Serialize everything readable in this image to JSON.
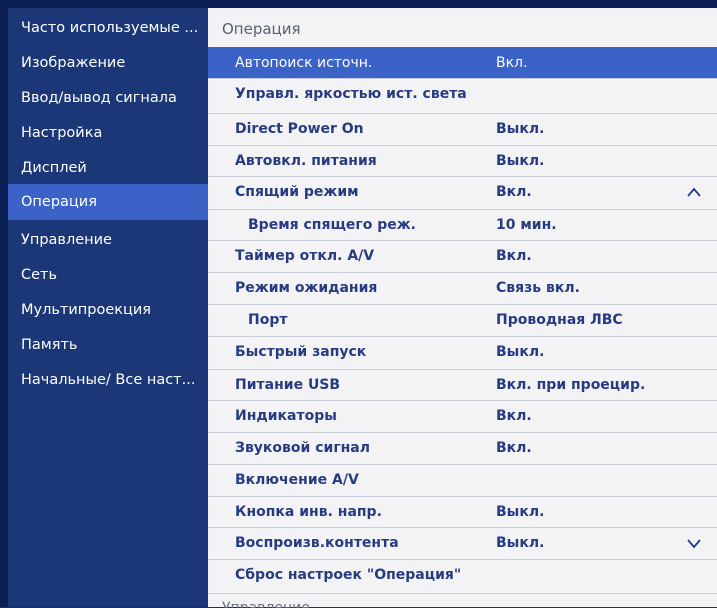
{
  "sidebar": {
    "items": [
      {
        "label": "Часто используемые ..."
      },
      {
        "label": "Изображение"
      },
      {
        "label": "Ввод/вывод сигнала"
      },
      {
        "label": "Настройка"
      },
      {
        "label": "Дисплей"
      },
      {
        "label": "Операция"
      },
      {
        "label": "Управление"
      },
      {
        "label": "Сеть"
      },
      {
        "label": "Мультипроекция"
      },
      {
        "label": "Память"
      },
      {
        "label": "Начальные/ Все наст..."
      }
    ],
    "selected": "Операция"
  },
  "main": {
    "title": "Операция",
    "rows": [
      {
        "label": "Автопоиск источн.",
        "value": "Вкл."
      },
      {
        "label": "Управл. яркостью ист. света",
        "value": ""
      },
      {
        "label": "Direct Power On",
        "value": "Выкл."
      },
      {
        "label": "Автовкл. питания",
        "value": "Выкл."
      },
      {
        "label": "Спящий режим",
        "value": "Вкл.",
        "arrow": "chevron-up-icon"
      },
      {
        "label": "Время спящего реж.",
        "value": "10 мин."
      },
      {
        "label": "Таймер откл. A/V",
        "value": "Вкл."
      },
      {
        "label": "Режим ожидания",
        "value": "Связь вкл."
      },
      {
        "label": "Порт",
        "value": "Проводная ЛВС"
      },
      {
        "label": "Быстрый запуск",
        "value": "Выкл."
      },
      {
        "label": "Питание USB",
        "value": "Вкл. при проецир."
      },
      {
        "label": "Индикаторы",
        "value": "Вкл."
      },
      {
        "label": "Звуковой сигнал",
        "value": "Вкл."
      },
      {
        "label": "Включение A/V",
        "value": ""
      },
      {
        "label": "Кнопка инв. напр.",
        "value": "Выкл."
      },
      {
        "label": "Воспроизв.контента",
        "value": "Выкл.",
        "arrow": "chevron-down-icon"
      },
      {
        "label": "Сброс настроек \"Операция\"",
        "value": ""
      }
    ],
    "next_section": "Управление"
  },
  "colors": {
    "background": "#0b1f55",
    "sidebar": "#1b3778",
    "highlight": "#3b62c7",
    "panel": "#f3f3f5",
    "row_text": "#283b82"
  }
}
